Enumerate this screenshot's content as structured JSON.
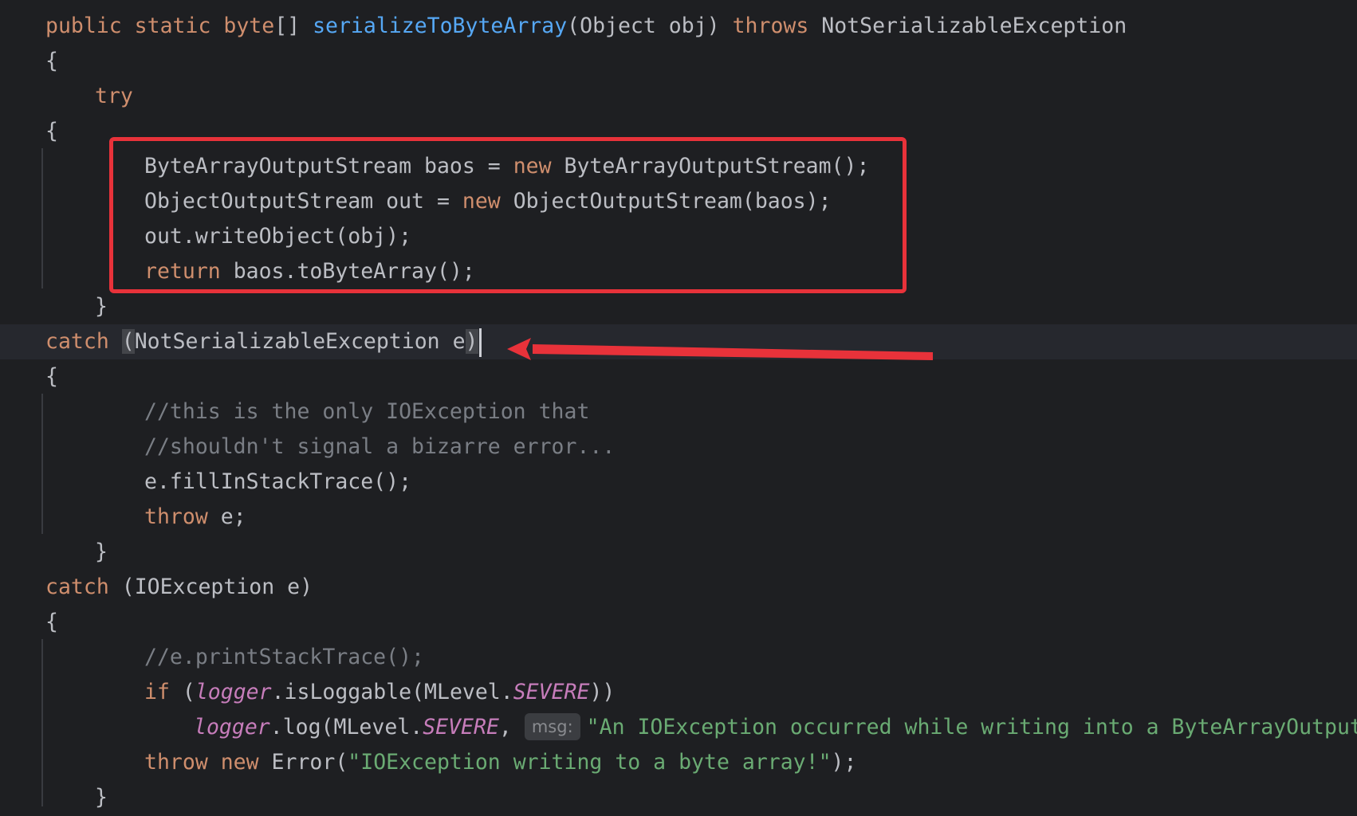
{
  "editor": {
    "lines": [
      {
        "id": "l1",
        "tokens": [
          {
            "t": "public static byte",
            "c": "kw"
          },
          {
            "t": "[] ",
            "c": "plain"
          },
          {
            "t": "serializeToByteArray",
            "c": "fn"
          },
          {
            "t": "(Object obj) ",
            "c": "plain"
          },
          {
            "t": "throws",
            "c": "kw"
          },
          {
            "t": " NotSerializableException",
            "c": "plain"
          }
        ]
      },
      {
        "id": "l2",
        "tokens": [
          {
            "t": "{",
            "c": "plain"
          }
        ]
      },
      {
        "id": "l3",
        "tokens": [
          {
            "t": "try",
            "c": "kw"
          }
        ]
      },
      {
        "id": "l4",
        "tokens": [
          {
            "t": "{",
            "c": "plain"
          }
        ]
      },
      {
        "id": "l5",
        "tokens": [
          {
            "t": "ByteArrayOutputStream baos = ",
            "c": "plain"
          },
          {
            "t": "new",
            "c": "kw"
          },
          {
            "t": " ByteArrayOutputStream();",
            "c": "plain"
          }
        ]
      },
      {
        "id": "l6",
        "tokens": [
          {
            "t": "ObjectOutputStream out = ",
            "c": "plain"
          },
          {
            "t": "new",
            "c": "kw"
          },
          {
            "t": " ObjectOutputStream(baos);",
            "c": "plain"
          }
        ]
      },
      {
        "id": "l7",
        "tokens": [
          {
            "t": "out.writeObject(obj);",
            "c": "plain"
          }
        ]
      },
      {
        "id": "l8",
        "tokens": [
          {
            "t": "return",
            "c": "kw"
          },
          {
            "t": " baos.toByteArray();",
            "c": "plain"
          }
        ]
      },
      {
        "id": "l9",
        "tokens": [
          {
            "t": "}",
            "c": "plain"
          }
        ]
      },
      {
        "id": "l10",
        "tokens": [
          {
            "t": "catch",
            "c": "kw"
          },
          {
            "t": " ",
            "c": "plain"
          },
          {
            "t": "(",
            "c": "plain paren-hl"
          },
          {
            "t": "NotSerializableException e",
            "c": "plain"
          },
          {
            "t": ")",
            "c": "plain paren-hl"
          }
        ]
      },
      {
        "id": "l11",
        "tokens": [
          {
            "t": "{",
            "c": "plain"
          }
        ]
      },
      {
        "id": "l12",
        "tokens": [
          {
            "t": "//this is the only IOException that",
            "c": "cm"
          }
        ]
      },
      {
        "id": "l13",
        "tokens": [
          {
            "t": "//shouldn't signal a bizarre error...",
            "c": "cm"
          }
        ]
      },
      {
        "id": "l14",
        "tokens": [
          {
            "t": "e.fillInStackTrace();",
            "c": "plain"
          }
        ]
      },
      {
        "id": "l15",
        "tokens": [
          {
            "t": "throw",
            "c": "kw"
          },
          {
            "t": " e;",
            "c": "plain"
          }
        ]
      },
      {
        "id": "l16",
        "tokens": [
          {
            "t": "}",
            "c": "plain"
          }
        ]
      },
      {
        "id": "l17",
        "tokens": [
          {
            "t": "catch",
            "c": "kw"
          },
          {
            "t": " (IOException e)",
            "c": "plain"
          }
        ]
      },
      {
        "id": "l18",
        "tokens": [
          {
            "t": "{",
            "c": "plain"
          }
        ]
      },
      {
        "id": "l19",
        "tokens": [
          {
            "t": "//e.printStackTrace();",
            "c": "cm"
          }
        ]
      },
      {
        "id": "l20",
        "tokens": [
          {
            "t": "if",
            "c": "kw"
          },
          {
            "t": " (",
            "c": "plain"
          },
          {
            "t": "logger",
            "c": "field"
          },
          {
            "t": ".isLoggable(MLevel.",
            "c": "plain"
          },
          {
            "t": "SEVERE",
            "c": "field"
          },
          {
            "t": "))",
            "c": "plain"
          }
        ]
      },
      {
        "id": "l21",
        "tokens": [
          {
            "t": "logger",
            "c": "field"
          },
          {
            "t": ".log(MLevel.",
            "c": "plain"
          },
          {
            "t": "SEVERE",
            "c": "field"
          },
          {
            "t": ", ",
            "c": "plain"
          },
          {
            "t": "msg:",
            "c": "hint"
          },
          {
            "t": "\"An IOException occurred while writing into a ByteArrayOutputS",
            "c": "str"
          }
        ]
      },
      {
        "id": "l22",
        "tokens": [
          {
            "t": "throw new",
            "c": "kw"
          },
          {
            "t": " Error(",
            "c": "plain"
          },
          {
            "t": "\"IOException writing to a byte array!\"",
            "c": "str"
          },
          {
            "t": ");",
            "c": "plain"
          }
        ]
      },
      {
        "id": "l23",
        "tokens": [
          {
            "t": "}",
            "c": "plain"
          }
        ]
      }
    ]
  },
  "annotations": {
    "box_color": "#e8323a",
    "arrow_color": "#e8323a"
  },
  "colors": {
    "background": "#1e1f22",
    "keyword": "#cf8e6d",
    "function": "#56a8f5",
    "comment": "#7a7e85",
    "string": "#6aab73",
    "field": "#c77dbb",
    "text": "#bcbec4"
  }
}
